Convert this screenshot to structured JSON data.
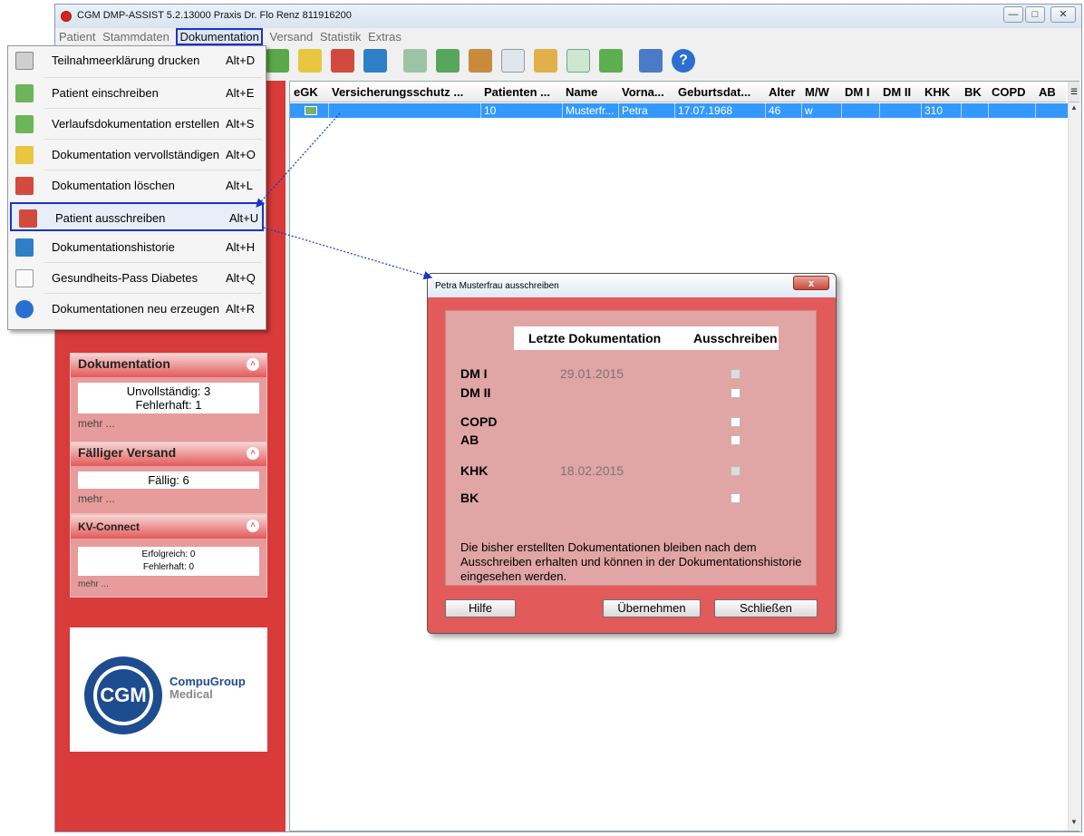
{
  "window": {
    "title": "CGM DMP-ASSIST 5.2.13000 Praxis Dr. Flo Renz 811916200",
    "controls": [
      "minimize",
      "maximize",
      "close"
    ]
  },
  "menubar": {
    "items": [
      "Patient",
      "Stammdaten",
      "Dokumentation",
      "Versand",
      "Statistik",
      "Extras"
    ]
  },
  "dropdown": {
    "items": [
      {
        "label": "Teilnahmeerklärung drucken",
        "shortcut": "Alt+D",
        "icon": "printer-icon"
      },
      {
        "label": "Patient einschreiben",
        "shortcut": "Alt+E",
        "icon": "document-add-icon"
      },
      {
        "label": "Verlaufsdokumentation erstellen",
        "shortcut": "Alt+S",
        "icon": "document-add-icon"
      },
      {
        "label": "Dokumentation vervollständigen",
        "shortcut": "Alt+O",
        "icon": "document-edit-icon"
      },
      {
        "label": "Dokumentation löschen",
        "shortcut": "Alt+L",
        "icon": "document-delete-icon"
      },
      {
        "label": "Patient ausschreiben",
        "shortcut": "Alt+U",
        "icon": "document-delete-icon"
      },
      {
        "label": "Dokumentationshistorie",
        "shortcut": "Alt+H",
        "icon": "history-icon"
      },
      {
        "label": "Gesundheits-Pass Diabetes",
        "shortcut": "Alt+Q",
        "icon": "page-icon"
      },
      {
        "label": "Dokumentationen neu erzeugen",
        "shortcut": "Alt+R",
        "icon": "refresh-icon"
      }
    ]
  },
  "table": {
    "columns": [
      "eGK",
      "Versicherungsschutz ...",
      "Patienten ...",
      "Name",
      "Vorna...",
      "Geburtsdat...",
      "Alter",
      "M/W",
      "DM I",
      "DM II",
      "KHK",
      "BK",
      "COPD",
      "AB"
    ],
    "rows": [
      [
        "",
        "",
        "10",
        "Musterfr...",
        "Petra",
        "17.07.1968",
        "46",
        "w",
        "",
        "",
        "310",
        "",
        "",
        ""
      ]
    ]
  },
  "leftpanel": {
    "dokumentation": {
      "title": "Dokumentation",
      "line1": "Unvollständig: 3",
      "line2": "Fehlerhaft: 1",
      "more": "mehr ..."
    },
    "versand": {
      "title": "Fälliger Versand",
      "line1": "Fällig: 6",
      "more": "mehr ..."
    },
    "kvconnect": {
      "title": "KV-Connect",
      "line1": "Erfolgreich: 0",
      "line2": "Fehlerhaft: 0",
      "more": "mehr ..."
    },
    "logo": {
      "brand": "CGM",
      "line1": "CompuGroup",
      "line2": "Medical"
    }
  },
  "dialog": {
    "title": "Petra Musterfrau ausschreiben",
    "close": "x",
    "col_doc": "Letzte Dokumentation",
    "col_out": "Ausschreiben",
    "rows": [
      {
        "label": "DM I",
        "date": "29.01.2015",
        "enabled": false
      },
      {
        "label": "DM II",
        "date": "",
        "enabled": true
      },
      {
        "label": "COPD",
        "date": "",
        "enabled": true
      },
      {
        "label": "AB",
        "date": "",
        "enabled": true
      },
      {
        "label": "KHK",
        "date": "18.02.2015",
        "enabled": false
      },
      {
        "label": "BK",
        "date": "",
        "enabled": true
      }
    ],
    "note": "Die bisher erstellten Dokumentationen bleiben nach dem Ausschreiben erhalten und können in der Dokumentationshistorie eingesehen werden.",
    "buttons": {
      "help": "Hilfe",
      "apply": "Übernehmen",
      "close": "Schließen"
    }
  },
  "colors": {
    "accent_red": "#d93a3a",
    "selection_blue": "#3399ff",
    "highlight_border": "#1a33c8"
  }
}
